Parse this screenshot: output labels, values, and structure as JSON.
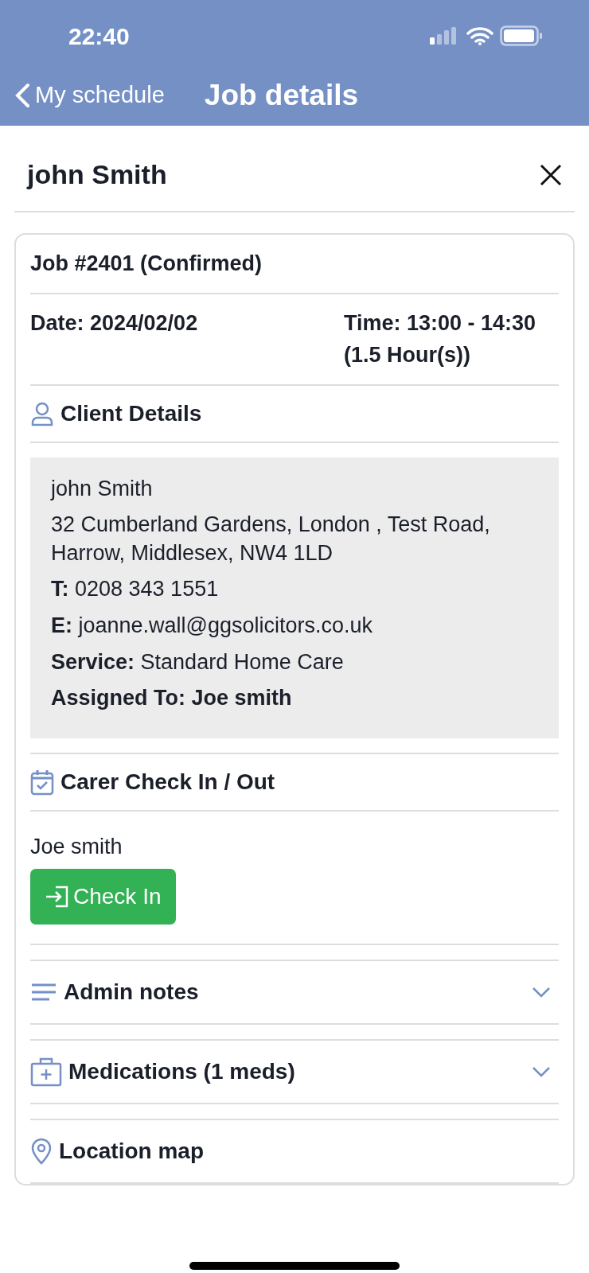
{
  "status_bar": {
    "time": "22:40"
  },
  "nav": {
    "back_label": "My schedule",
    "title": "Job details"
  },
  "modal": {
    "title": "john Smith"
  },
  "job": {
    "heading": "Job #2401 (Confirmed)",
    "date": "Date: 2024/02/02",
    "time": "Time: 13:00 - 14:30 (1.5 Hour(s))"
  },
  "sections": [
    {
      "kind": "client",
      "title": "Client Details",
      "lines": [
        "john Smith",
        "32 Cumberland Gardens, London , Test Road, Harrow, Middlesex, NW4 1LD",
        "**T:** 0208 343 1551",
        "**E:**  joanne.wall@ggsolicitors.co.uk",
        "**Service:** Standard Home Care",
        "**Assigned To: Joe smith**"
      ]
    },
    {
      "kind": "checkin",
      "title": "Carer Check In / Out",
      "carer": "Joe smith",
      "button": "Check In"
    },
    {
      "kind": "notes",
      "title": "Admin notes",
      "expanded": false
    },
    {
      "kind": "medications",
      "title": "Medications (1 meds)",
      "expanded": false
    },
    {
      "kind": "location",
      "title": "Location map"
    }
  ]
}
